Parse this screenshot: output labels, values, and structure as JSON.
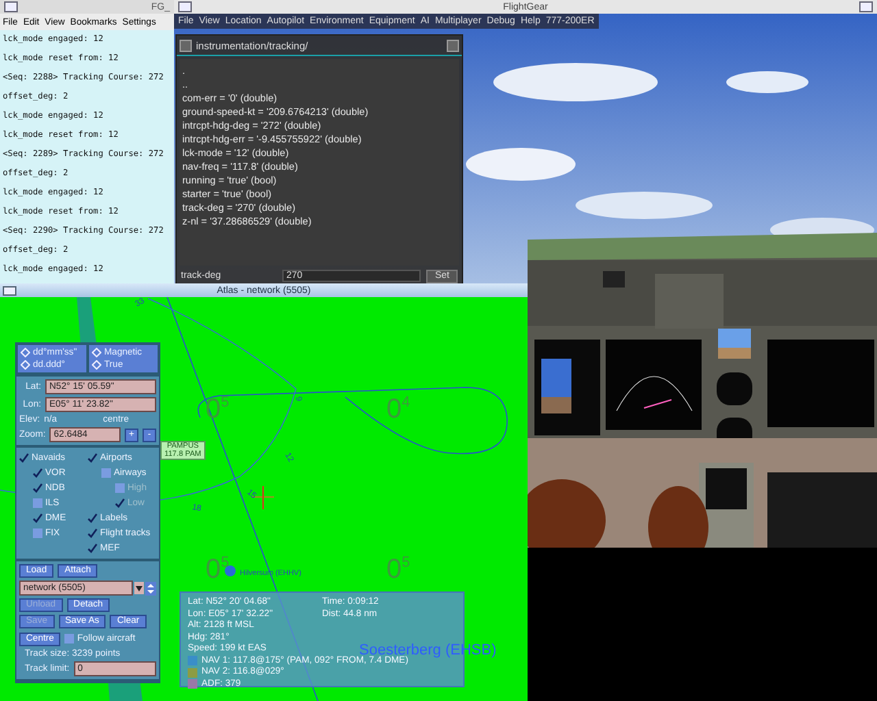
{
  "terminal": {
    "title": "FG_",
    "menu": [
      "File",
      "Edit",
      "View",
      "Bookmarks",
      "Settings"
    ],
    "lines": [
      "lck_mode engaged: 12",
      "lck_mode reset from: 12",
      "<Seq: 2288> Tracking Course: 272",
      "offset_deg: 2",
      "lck_mode engaged: 12",
      "lck_mode reset from: 12",
      "<Seq: 2289> Tracking Course: 272",
      "offset_deg: 2",
      "lck_mode engaged: 12",
      "lck_mode reset from: 12",
      "<Seq: 2290> Tracking Course: 272",
      "offset_deg: 2",
      "lck_mode engaged: 12"
    ]
  },
  "flightgear": {
    "title": "FlightGear",
    "menu": [
      "File",
      "View",
      "Location",
      "Autopilot",
      "Environment",
      "Equipment",
      "AI",
      "Multiplayer",
      "Debug",
      "Help",
      "777-200ER"
    ]
  },
  "property_browser": {
    "path": "instrumentation/tracking/",
    "entries": [
      ".",
      "..",
      "com-err = '0' (double)",
      "ground-speed-kt = '209.6764213' (double)",
      "intrcpt-hdg-deg = '272' (double)",
      "intrcpt-hdg-err = '-9.455755922' (double)",
      "lck-mode = '12' (double)",
      "nav-freq = '117.8' (double)",
      "running = 'true' (bool)",
      "starter = 'true' (bool)",
      "track-deg = '270' (double)",
      "z-nl = '37.28686529' (double)"
    ],
    "field_label": "track-deg",
    "field_value": "270",
    "set_button": "Set"
  },
  "atlas": {
    "title": "Atlas - network (5505)",
    "format_options": [
      {
        "label": "dd°mm'ss\"",
        "selected": false
      },
      {
        "label": "dd.ddd°",
        "selected": false
      }
    ],
    "heading_options": [
      {
        "label": "Magnetic",
        "selected": false
      },
      {
        "label": "True",
        "selected": false
      }
    ],
    "lat_label": "Lat:",
    "lat": "N52° 15' 05.59\"",
    "lon_label": "Lon:",
    "lon": "E05° 11' 23.82\"",
    "elev_label": "Elev:",
    "elev": "n/a",
    "centre_label": "centre",
    "zoom_label": "Zoom:",
    "zoom": "62.6484",
    "zoom_in": "+",
    "zoom_out": "-",
    "layers": [
      {
        "label": "Navaids",
        "checked": true,
        "disabled": false,
        "children": [
          {
            "label": "VOR",
            "checked": true,
            "disabled": false
          },
          {
            "label": "NDB",
            "checked": true,
            "disabled": false
          },
          {
            "label": "ILS",
            "checked": false,
            "disabled": false
          },
          {
            "label": "DME",
            "checked": true,
            "disabled": false
          },
          {
            "label": "FIX",
            "checked": false,
            "disabled": false
          }
        ]
      },
      {
        "label": "Airports",
        "checked": true,
        "disabled": false,
        "children": [
          {
            "label": "Airways",
            "checked": false,
            "disabled": false,
            "children": [
              {
                "label": "High",
                "checked": false,
                "disabled": true
              },
              {
                "label": "Low",
                "checked": true,
                "disabled": true
              }
            ]
          }
        ]
      },
      {
        "label": "Labels",
        "checked": true,
        "disabled": false
      },
      {
        "label": "Flight tracks",
        "checked": true,
        "disabled": false
      },
      {
        "label": "MEF",
        "checked": true,
        "disabled": false
      }
    ],
    "row1": [
      {
        "label": "Load",
        "disabled": false
      },
      {
        "label": "Attach",
        "disabled": false
      }
    ],
    "source": "network (5505)",
    "row2": [
      {
        "label": "Unload",
        "disabled": true
      },
      {
        "label": "Detach",
        "disabled": false
      }
    ],
    "row3": [
      {
        "label": "Save",
        "disabled": true
      },
      {
        "label": "Save As",
        "disabled": false
      },
      {
        "label": "Clear",
        "disabled": false
      }
    ],
    "centre_button": {
      "label": "Centre",
      "disabled": false
    },
    "follow": {
      "label": "Follow aircraft",
      "checked": false
    },
    "track_size": "Track size: 3239 points",
    "track_limit_label": "Track limit:",
    "track_limit": "0",
    "map": {
      "mef_labels": [
        {
          "thousands": "0",
          "hundreds": "5"
        },
        {
          "thousands": "0",
          "hundreds": "4"
        },
        {
          "thousands": "0",
          "hundreds": "5"
        },
        {
          "thousands": "0",
          "hundreds": "5"
        }
      ],
      "compass_labels": [
        "33",
        "9",
        "12",
        "15",
        "18"
      ],
      "vor_name": "PAMPUS",
      "vor_freq": "117.8 PAM",
      "airport": "Hilversum (EHHV)",
      "airport_2": "Soesterberg (EHSB)"
    },
    "info": {
      "left": [
        "Lat: N52° 20' 04.68\"",
        "Lon: E05° 17' 32.22\"",
        "Alt: 2128 ft MSL",
        "Hdg: 281°",
        "Speed: 199 kt EAS"
      ],
      "right": [
        "Time: 0:09:12",
        "Dist: 44.8 nm"
      ],
      "radios": [
        {
          "label": "NAV 1: 117.8@175° (PAM, 092° FROM, 7.4 DME)",
          "color": "#3a8ec8"
        },
        {
          "label": "NAV 2: 116.8@029°",
          "color": "#8c9c44"
        },
        {
          "label": "ADF: 379",
          "color": "#9a78a8"
        }
      ]
    }
  }
}
